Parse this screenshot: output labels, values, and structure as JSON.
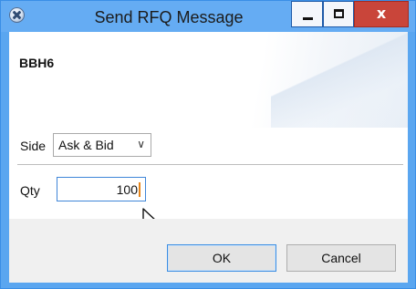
{
  "window": {
    "title": "Send RFQ Message",
    "controls": {
      "close_glyph": "x"
    }
  },
  "header": {
    "instrument": "BBH6"
  },
  "form": {
    "side": {
      "label": "Side",
      "selected": "Ask & Bid",
      "chevron": "∨"
    },
    "qty": {
      "label": "Qty",
      "value": "100"
    }
  },
  "buttons": {
    "ok_label": "OK",
    "cancel_label": "Cancel"
  }
}
